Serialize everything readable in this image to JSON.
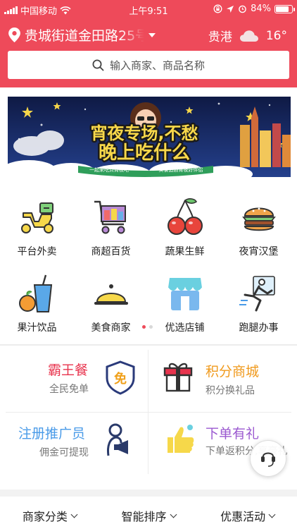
{
  "status_bar": {
    "carrier": "中国移动",
    "time": "上午9:51",
    "battery": "84%",
    "battery_level": 0.84
  },
  "header": {
    "location": "贵城街道金田路25号",
    "weather_city": "贵港",
    "temperature": "16°",
    "weather_icon": "cloud-icon",
    "search_placeholder": "输入商家、商品名称",
    "background_color": "#ee4a5a"
  },
  "banner": {
    "headline_line1": "宵夜专场,不愁",
    "headline_line2": "晚上吃什么",
    "ribbon_left": "一起来吃点宵夜吧",
    "ribbon_right": "美食追剧宵夜好伴侣"
  },
  "categories": [
    {
      "label": "平台外卖",
      "icon": "scooter-icon"
    },
    {
      "label": "商超百货",
      "icon": "shopping-cart-icon"
    },
    {
      "label": "蔬果生鲜",
      "icon": "cherry-icon"
    },
    {
      "label": "夜宵汉堡",
      "icon": "burger-icon"
    },
    {
      "label": "果汁饮品",
      "icon": "drink-icon"
    },
    {
      "label": "美食商家",
      "icon": "food-cloche-icon"
    },
    {
      "label": "优选店铺",
      "icon": "storefront-icon"
    },
    {
      "label": "跑腿办事",
      "icon": "runner-icon"
    }
  ],
  "page_indicator": {
    "count": 2,
    "active": 1
  },
  "promos": [
    {
      "title": "霸王餐",
      "subtitle": "全民免单",
      "icon_text": "免",
      "color": "#e8344e"
    },
    {
      "title": "积分商城",
      "subtitle": "积分换礼品",
      "color": "#f09a1d"
    },
    {
      "title": "注册推广员",
      "subtitle": "佣金可提现",
      "color": "#4a9be8"
    },
    {
      "title": "下单有礼",
      "subtitle": "下单返积分,享豪礼",
      "color": "#9b59d0"
    }
  ],
  "sort_bar": [
    {
      "label": "商家分类"
    },
    {
      "label": "智能排序"
    },
    {
      "label": "优惠活动"
    }
  ]
}
